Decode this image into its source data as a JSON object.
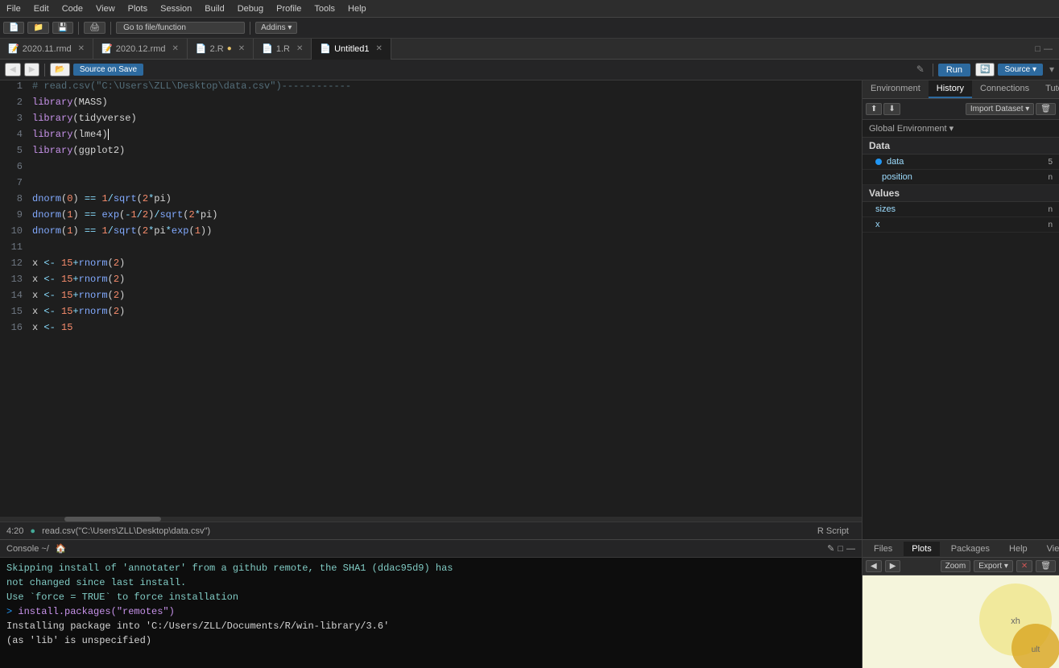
{
  "menubar": {
    "items": [
      "File",
      "Edit",
      "Code",
      "View",
      "Plots",
      "Session",
      "Build",
      "Debug",
      "Profile",
      "Tools",
      "Help"
    ]
  },
  "toolbar": {
    "go_to_function": "Go to file/function",
    "addins": "Addins ▾"
  },
  "tabs": [
    {
      "label": "2020.11.rmd",
      "active": false,
      "modified": false
    },
    {
      "label": "2020.12.rmd",
      "active": false,
      "modified": false
    },
    {
      "label": "2.R",
      "active": false,
      "modified": true
    },
    {
      "label": "1.R",
      "active": false,
      "modified": false
    },
    {
      "label": "Untitled1",
      "active": true,
      "modified": false
    }
  ],
  "source_toolbar": {
    "source_label": "Source on Save",
    "run_label": "Run",
    "source_btn": "Source ▾"
  },
  "code": [
    {
      "num": "1",
      "content": "# read.csv(\"C:\\Users\\ZLL\\Desktop\\data.csv\")------------"
    },
    {
      "num": "2",
      "content": "library(MASS)"
    },
    {
      "num": "3",
      "content": "library(tidyverse)"
    },
    {
      "num": "4",
      "content": "library(lme4)"
    },
    {
      "num": "5",
      "content": "library(ggplot2)"
    },
    {
      "num": "6",
      "content": ""
    },
    {
      "num": "7",
      "content": ""
    },
    {
      "num": "8",
      "content": "dnorm(0) == 1/sqrt(2*pi)"
    },
    {
      "num": "9",
      "content": "dnorm(1) == exp(-1/2)/sqrt(2*pi)"
    },
    {
      "num": "10",
      "content": "dnorm(1) == 1/sqrt(2*pi*exp(1))"
    },
    {
      "num": "11",
      "content": ""
    },
    {
      "num": "12",
      "content": "x <- 15+rnorm(2)"
    },
    {
      "num": "13",
      "content": "x <- 15+rnorm(2)"
    },
    {
      "num": "14",
      "content": "x <- 15+rnorm(2)"
    },
    {
      "num": "15",
      "content": "x <- 15+rnorm(2)"
    },
    {
      "num": "16",
      "content": "x <- 15"
    }
  ],
  "status_bar": {
    "position": "4:20",
    "file": "read.csv(\"C:\\Users\\ZLL\\Desktop\\data.csv\")",
    "script_type": "R Script"
  },
  "right_panel": {
    "tabs": [
      "Environment",
      "History",
      "Connections",
      "Tutorial"
    ],
    "active_tab": "History",
    "toolbar_btns": [
      "⬆",
      "⬇",
      "📋",
      "🗑",
      "↗"
    ],
    "import_dataset": "Import Dataset ▾",
    "env_label": "Global Environment ▾",
    "sections": {
      "data_title": "Data",
      "values_title": "Values",
      "data_items": [
        {
          "name": "data",
          "dot": true,
          "val": "5"
        },
        {
          "name": "position",
          "dot": false,
          "val": "n"
        }
      ],
      "value_items": [
        {
          "name": "sizes",
          "val": "n"
        },
        {
          "name": "x",
          "val": "n"
        }
      ]
    }
  },
  "bottom_tabs": {
    "files_label": "Files",
    "plots_label": "Plots",
    "packages_label": "Packages",
    "help_label": "Help",
    "viewer_label": "Viewer",
    "zoom_label": "Zoom",
    "export_label": "Export ▾"
  },
  "console": {
    "title": "Console ~/",
    "lines": [
      "Skipping install of 'annotater' from a github remote, the SHA1 (ddac95d9) has",
      "not changed since last install.",
      "  Use `force = TRUE` to force installation",
      "> install.packages(\"remotes\")",
      "Installing package into 'C:/Users/ZLL/Documents/R/win-library/3.6'",
      "(as 'lib' is unspecified)"
    ]
  }
}
